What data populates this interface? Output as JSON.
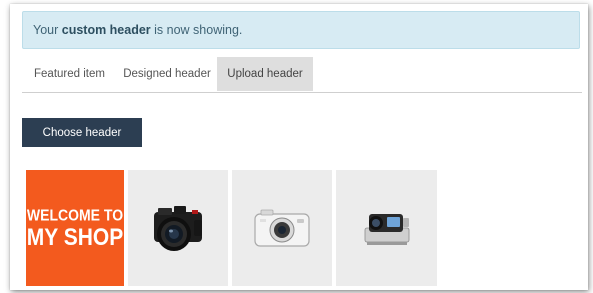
{
  "alert": {
    "prefix": "Your ",
    "strong": "custom header",
    "suffix": " is now showing."
  },
  "tabs": [
    {
      "label": "Featured item",
      "active": false
    },
    {
      "label": "Designed header",
      "active": false
    },
    {
      "label": "Upload header",
      "active": true
    }
  ],
  "choose_button": {
    "label": "Choose header"
  },
  "thumbnails": [
    {
      "type": "text-banner",
      "line1": "WELCOME TO",
      "line2": "MY SHOP",
      "bg": "#f35a1e"
    },
    {
      "type": "image",
      "icon": "dslr-camera-icon"
    },
    {
      "type": "image",
      "icon": "compact-camera-icon"
    },
    {
      "type": "image",
      "icon": "action-camera-icon"
    }
  ],
  "colors": {
    "alert_bg": "#d7ebf3",
    "button_bg": "#2c3e52",
    "active_tab_bg": "#dedede",
    "banner_bg": "#f35a1e"
  }
}
